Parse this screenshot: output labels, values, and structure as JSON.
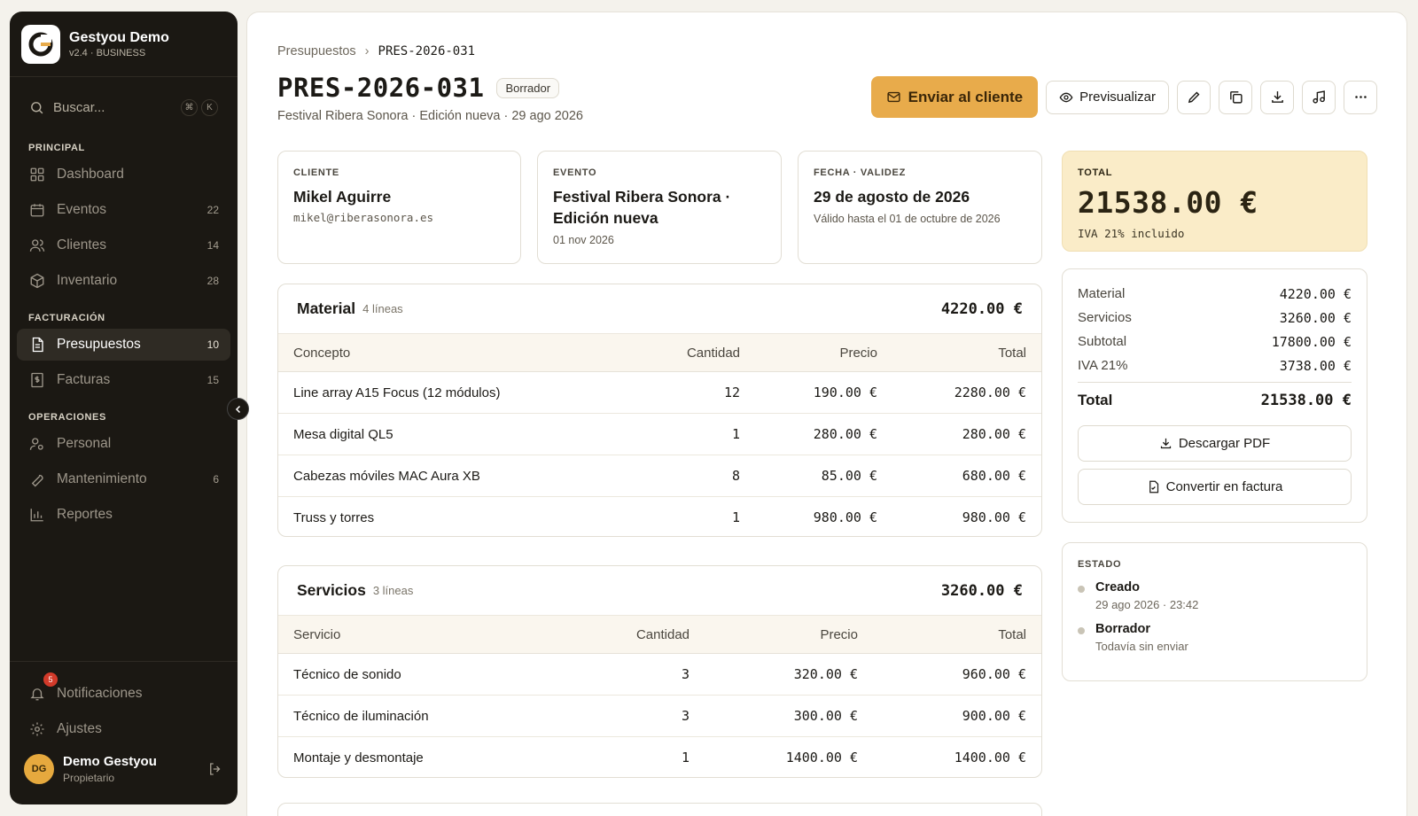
{
  "brand": {
    "name": "Gestyou Demo",
    "version": "v2.4 · BUSINESS"
  },
  "search": {
    "placeholder": "Buscar...",
    "kbd1": "⌘",
    "kbd2": "K"
  },
  "sidebar": {
    "sections": [
      {
        "label": "PRINCIPAL"
      },
      {
        "label": "FACTURACIÓN"
      },
      {
        "label": "OPERACIONES"
      }
    ],
    "items": [
      {
        "label": "Dashboard",
        "count": "",
        "icon": "grid-icon"
      },
      {
        "label": "Eventos",
        "count": "22",
        "icon": "calendar-icon"
      },
      {
        "label": "Clientes",
        "count": "14",
        "icon": "users-icon"
      },
      {
        "label": "Inventario",
        "count": "28",
        "icon": "box-icon"
      },
      {
        "label": "Presupuestos",
        "count": "10",
        "icon": "document-icon"
      },
      {
        "label": "Facturas",
        "count": "15",
        "icon": "invoice-icon"
      },
      {
        "label": "Personal",
        "count": "",
        "icon": "staff-icon"
      },
      {
        "label": "Mantenimiento",
        "count": "6",
        "icon": "wrench-icon"
      },
      {
        "label": "Reportes",
        "count": "",
        "icon": "chart-icon"
      }
    ],
    "notifications": {
      "label": "Notificaciones",
      "badge": "5"
    },
    "settings": {
      "label": "Ajustes"
    },
    "user": {
      "initials": "DG",
      "name": "Demo Gestyou",
      "role": "Propietario"
    }
  },
  "breadcrumb": {
    "parent": "Presupuestos",
    "current": "PRES-2026-031"
  },
  "header": {
    "title": "PRES-2026-031",
    "status": "Borrador",
    "subtitle": "Festival Ribera Sonora · Edición nueva · 29 ago 2026",
    "send_label": "Enviar al cliente",
    "preview_label": "Previsualizar"
  },
  "info": {
    "client": {
      "label": "CLIENTE",
      "name": "Mikel Aguirre",
      "email": "mikel@riberasonora.es"
    },
    "event": {
      "label": "EVENTO",
      "name": "Festival Ribera Sonora · Edición nueva",
      "date": "01 nov 2026"
    },
    "date": {
      "label": "FECHA · VALIDEZ",
      "value": "29 de agosto de 2026",
      "valid": "Válido hasta el 01 de octubre de 2026"
    }
  },
  "material": {
    "title": "Material",
    "lines": "4 líneas",
    "total": "4220.00 €",
    "headers": [
      "Concepto",
      "Cantidad",
      "Precio",
      "Total"
    ],
    "rows": [
      [
        "Line array A15 Focus (12 módulos)",
        "12",
        "190.00 €",
        "2280.00 €"
      ],
      [
        "Mesa digital QL5",
        "1",
        "280.00 €",
        "280.00 €"
      ],
      [
        "Cabezas móviles MAC Aura XB",
        "8",
        "85.00 €",
        "680.00 €"
      ],
      [
        "Truss y torres",
        "1",
        "980.00 €",
        "980.00 €"
      ]
    ]
  },
  "services": {
    "title": "Servicios",
    "lines": "3 líneas",
    "total": "3260.00 €",
    "headers": [
      "Servicio",
      "Cantidad",
      "Precio",
      "Total"
    ],
    "rows": [
      [
        "Técnico de sonido",
        "3",
        "320.00 €",
        "960.00 €"
      ],
      [
        "Técnico de iluminación",
        "3",
        "300.00 €",
        "900.00 €"
      ],
      [
        "Montaje y desmontaje",
        "1",
        "1400.00 €",
        "1400.00 €"
      ]
    ]
  },
  "summary": {
    "label": "TOTAL",
    "amount": "21538.00 €",
    "note": "IVA 21% incluido",
    "rows": [
      {
        "label": "Material",
        "value": "4220.00 €"
      },
      {
        "label": "Servicios",
        "value": "3260.00 €"
      },
      {
        "label": "Subtotal",
        "value": "17800.00 €"
      },
      {
        "label": "IVA 21%",
        "value": "3738.00 €"
      }
    ],
    "total_label": "Total",
    "total_value": "21538.00 €",
    "download_label": "Descargar PDF",
    "convert_label": "Convertir en factura"
  },
  "status_panel": {
    "label": "ESTADO",
    "events": [
      {
        "title": "Creado",
        "sub": "29 ago 2026 · 23:42"
      },
      {
        "title": "Borrador",
        "sub": "Todavía sin enviar"
      }
    ]
  },
  "colors": {
    "accent": "#e8ab4b",
    "sidebar": "#1b1813",
    "total_bg": "#faecc8"
  }
}
